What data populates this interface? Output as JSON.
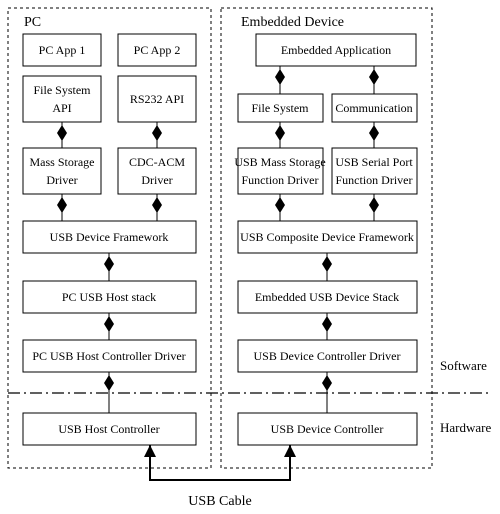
{
  "pc": {
    "title": "PC",
    "app1": "PC App 1",
    "app2": "PC App 2",
    "file_system_api_l1": "File System",
    "file_system_api_l2": "API",
    "rs232_api": "RS232 API",
    "mass_storage_l1": "Mass Storage",
    "mass_storage_l2": "Driver",
    "cdc_acm_l1": "CDC-ACM",
    "cdc_acm_l2": "Driver",
    "usb_device_framework": "USB Device Framework",
    "pc_usb_host_stack": "PC USB Host stack",
    "pc_usb_host_ctrl_driver": "PC USB Host Controller Driver",
    "usb_host_controller": "USB Host Controller"
  },
  "embedded": {
    "title": "Embedded Device",
    "app": "Embedded Application",
    "file_system": "File System",
    "communication": "Communication",
    "usb_ms_fn_l1": "USB Mass Storage",
    "usb_ms_fn_l2": "Function Driver",
    "usb_serial_fn_l1": "USB Serial Port",
    "usb_serial_fn_l2": "Function Driver",
    "usb_composite_fw": "USB Composite Device Framework",
    "embedded_usb_stack": "Embedded USB Device Stack",
    "usb_dev_ctrl_driver": "USB Device Controller Driver",
    "usb_device_controller": "USB Device Controller"
  },
  "labels": {
    "software": "Software",
    "hardware": "Hardware",
    "usb_cable": "USB Cable"
  }
}
